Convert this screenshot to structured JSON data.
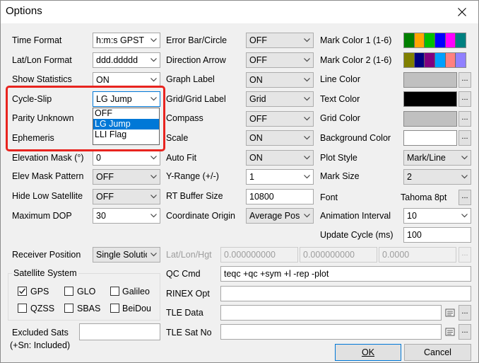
{
  "window": {
    "title": "Options"
  },
  "col1": {
    "time_format": {
      "label": "Time Format",
      "value": "h:m:s GPST"
    },
    "latlon_format": {
      "label": "Lat/Lon Format",
      "value": "ddd.ddddd"
    },
    "show_statistics": {
      "label": "Show Statistics",
      "value": "ON"
    },
    "cycle_slip": {
      "label": "Cycle-Slip",
      "value": "LG Jump",
      "options": [
        "OFF",
        "LG Jump",
        "LLI Flag"
      ],
      "selected": "LG Jump"
    },
    "parity_unknown": {
      "label": "Parity Unknown"
    },
    "ephemeris": {
      "label": "Ephemeris"
    },
    "elevation_mask": {
      "label": "Elevation Mask (°)",
      "value": "0"
    },
    "elev_mask_pattern": {
      "label": "Elev Mask Pattern",
      "value": "OFF"
    },
    "hide_low_satellite": {
      "label": "Hide Low Satellite",
      "value": "OFF"
    },
    "maximum_dop": {
      "label": "Maximum DOP",
      "value": "30"
    }
  },
  "col2": {
    "error_bar": {
      "label": "Error Bar/Circle",
      "value": "OFF"
    },
    "direction_arrow": {
      "label": "Direction Arrow",
      "value": "OFF"
    },
    "graph_label": {
      "label": "Graph Label",
      "value": "ON"
    },
    "grid_label": {
      "label": "Grid/Grid Label",
      "value": "Grid"
    },
    "compass": {
      "label": "Compass",
      "value": "OFF"
    },
    "scale": {
      "label": "Scale",
      "value": "ON"
    },
    "auto_fit": {
      "label": "Auto Fit",
      "value": "ON"
    },
    "y_range": {
      "label": "Y-Range (+/-)",
      "value": "1"
    },
    "rt_buffer": {
      "label": "RT Buffer Size",
      "value": "10800"
    },
    "coord_origin": {
      "label": "Coordinate Origin",
      "value": "Average Pos"
    }
  },
  "col3": {
    "mark_color1": {
      "label": "Mark Color 1 (1-6)",
      "colors": [
        "#008000",
        "#ffa500",
        "#00c000",
        "#0000ff",
        "#ff00ff",
        "#008080"
      ]
    },
    "mark_color2": {
      "label": "Mark Color 2 (1-6)",
      "colors": [
        "#808000",
        "#000080",
        "#800080",
        "#00a0ff",
        "#ff8080",
        "#9080ff"
      ]
    },
    "line_color": {
      "label": "Line Color",
      "color": "#c0c0c0"
    },
    "text_color": {
      "label": "Text Color",
      "color": "#000000"
    },
    "grid_color": {
      "label": "Grid Color",
      "color": "#c0c0c0"
    },
    "background_color": {
      "label": "Background Color",
      "color": "#ffffff"
    },
    "plot_style": {
      "label": "Plot Style",
      "value": "Mark/Line"
    },
    "mark_size": {
      "label": "Mark Size",
      "value": "2"
    },
    "font": {
      "label": "Font",
      "value": "Tahoma 8pt"
    },
    "animation_interval": {
      "label": "Animation Interval",
      "value": "10"
    },
    "update_cycle": {
      "label": "Update Cycle (ms)",
      "value": "100"
    }
  },
  "receiver": {
    "label": "Receiver Position",
    "value": "Single Solution",
    "latlonhgt_label": "Lat/Lon/Hgt",
    "lat": "0.000000000",
    "lon": "0.000000000",
    "hgt": "0.0000"
  },
  "satsys": {
    "title": "Satellite System",
    "items": [
      {
        "label": "GPS",
        "checked": true
      },
      {
        "label": "GLO",
        "checked": false
      },
      {
        "label": "Galileo",
        "checked": false
      },
      {
        "label": "QZSS",
        "checked": false
      },
      {
        "label": "SBAS",
        "checked": false
      },
      {
        "label": "BeiDou",
        "checked": false
      }
    ]
  },
  "excluded": {
    "label_line1": "Excluded Sats",
    "label_line2": "(+Sn: Included)",
    "value": ""
  },
  "qc": {
    "label": "QC Cmd",
    "value": "teqc +qc +sym +l -rep -plot"
  },
  "rinex": {
    "label": "RINEX Opt",
    "value": ""
  },
  "tle_data": {
    "label": "TLE Data",
    "value": ""
  },
  "tle_sat": {
    "label": "TLE Sat No",
    "value": ""
  },
  "buttons": {
    "ok": "OK",
    "cancel": "Cancel",
    "dots": "..."
  }
}
